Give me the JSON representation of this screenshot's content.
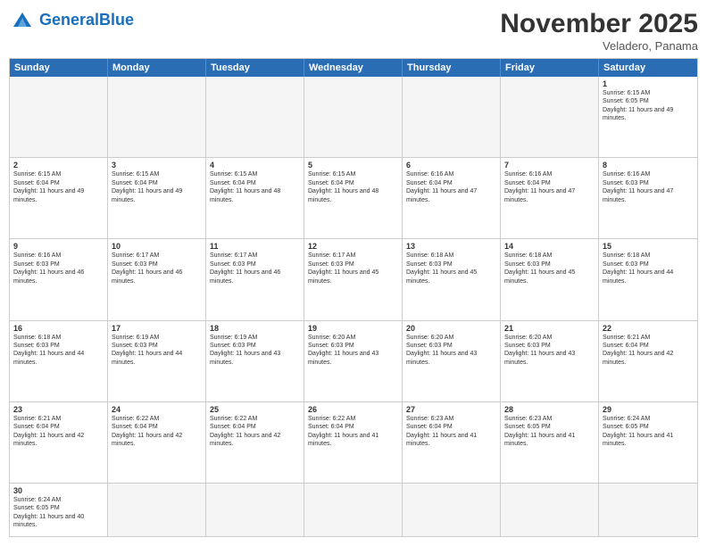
{
  "header": {
    "logo_general": "General",
    "logo_blue": "Blue",
    "title": "November 2025",
    "subtitle": "Veladero, Panama"
  },
  "days_of_week": [
    "Sunday",
    "Monday",
    "Tuesday",
    "Wednesday",
    "Thursday",
    "Friday",
    "Saturday"
  ],
  "weeks": [
    [
      {
        "day": "",
        "empty": true
      },
      {
        "day": "",
        "empty": true
      },
      {
        "day": "",
        "empty": true
      },
      {
        "day": "",
        "empty": true
      },
      {
        "day": "",
        "empty": true
      },
      {
        "day": "",
        "empty": true
      },
      {
        "day": "1",
        "sunrise": "Sunrise: 6:15 AM",
        "sunset": "Sunset: 6:05 PM",
        "daylight": "Daylight: 11 hours and 49 minutes."
      }
    ],
    [
      {
        "day": "2",
        "sunrise": "Sunrise: 6:15 AM",
        "sunset": "Sunset: 6:04 PM",
        "daylight": "Daylight: 11 hours and 49 minutes."
      },
      {
        "day": "3",
        "sunrise": "Sunrise: 6:15 AM",
        "sunset": "Sunset: 6:04 PM",
        "daylight": "Daylight: 11 hours and 49 minutes."
      },
      {
        "day": "4",
        "sunrise": "Sunrise: 6:15 AM",
        "sunset": "Sunset: 6:04 PM",
        "daylight": "Daylight: 11 hours and 48 minutes."
      },
      {
        "day": "5",
        "sunrise": "Sunrise: 6:15 AM",
        "sunset": "Sunset: 6:04 PM",
        "daylight": "Daylight: 11 hours and 48 minutes."
      },
      {
        "day": "6",
        "sunrise": "Sunrise: 6:16 AM",
        "sunset": "Sunset: 6:04 PM",
        "daylight": "Daylight: 11 hours and 47 minutes."
      },
      {
        "day": "7",
        "sunrise": "Sunrise: 6:16 AM",
        "sunset": "Sunset: 6:04 PM",
        "daylight": "Daylight: 11 hours and 47 minutes."
      },
      {
        "day": "8",
        "sunrise": "Sunrise: 6:16 AM",
        "sunset": "Sunset: 6:03 PM",
        "daylight": "Daylight: 11 hours and 47 minutes."
      }
    ],
    [
      {
        "day": "9",
        "sunrise": "Sunrise: 6:16 AM",
        "sunset": "Sunset: 6:03 PM",
        "daylight": "Daylight: 11 hours and 46 minutes."
      },
      {
        "day": "10",
        "sunrise": "Sunrise: 6:17 AM",
        "sunset": "Sunset: 6:03 PM",
        "daylight": "Daylight: 11 hours and 46 minutes."
      },
      {
        "day": "11",
        "sunrise": "Sunrise: 6:17 AM",
        "sunset": "Sunset: 6:03 PM",
        "daylight": "Daylight: 11 hours and 46 minutes."
      },
      {
        "day": "12",
        "sunrise": "Sunrise: 6:17 AM",
        "sunset": "Sunset: 6:03 PM",
        "daylight": "Daylight: 11 hours and 45 minutes."
      },
      {
        "day": "13",
        "sunrise": "Sunrise: 6:18 AM",
        "sunset": "Sunset: 6:03 PM",
        "daylight": "Daylight: 11 hours and 45 minutes."
      },
      {
        "day": "14",
        "sunrise": "Sunrise: 6:18 AM",
        "sunset": "Sunset: 6:03 PM",
        "daylight": "Daylight: 11 hours and 45 minutes."
      },
      {
        "day": "15",
        "sunrise": "Sunrise: 6:18 AM",
        "sunset": "Sunset: 6:03 PM",
        "daylight": "Daylight: 11 hours and 44 minutes."
      }
    ],
    [
      {
        "day": "16",
        "sunrise": "Sunrise: 6:18 AM",
        "sunset": "Sunset: 6:03 PM",
        "daylight": "Daylight: 11 hours and 44 minutes."
      },
      {
        "day": "17",
        "sunrise": "Sunrise: 6:19 AM",
        "sunset": "Sunset: 6:03 PM",
        "daylight": "Daylight: 11 hours and 44 minutes."
      },
      {
        "day": "18",
        "sunrise": "Sunrise: 6:19 AM",
        "sunset": "Sunset: 6:03 PM",
        "daylight": "Daylight: 11 hours and 43 minutes."
      },
      {
        "day": "19",
        "sunrise": "Sunrise: 6:20 AM",
        "sunset": "Sunset: 6:03 PM",
        "daylight": "Daylight: 11 hours and 43 minutes."
      },
      {
        "day": "20",
        "sunrise": "Sunrise: 6:20 AM",
        "sunset": "Sunset: 6:03 PM",
        "daylight": "Daylight: 11 hours and 43 minutes."
      },
      {
        "day": "21",
        "sunrise": "Sunrise: 6:20 AM",
        "sunset": "Sunset: 6:03 PM",
        "daylight": "Daylight: 11 hours and 43 minutes."
      },
      {
        "day": "22",
        "sunrise": "Sunrise: 6:21 AM",
        "sunset": "Sunset: 6:04 PM",
        "daylight": "Daylight: 11 hours and 42 minutes."
      }
    ],
    [
      {
        "day": "23",
        "sunrise": "Sunrise: 6:21 AM",
        "sunset": "Sunset: 6:04 PM",
        "daylight": "Daylight: 11 hours and 42 minutes."
      },
      {
        "day": "24",
        "sunrise": "Sunrise: 6:22 AM",
        "sunset": "Sunset: 6:04 PM",
        "daylight": "Daylight: 11 hours and 42 minutes."
      },
      {
        "day": "25",
        "sunrise": "Sunrise: 6:22 AM",
        "sunset": "Sunset: 6:04 PM",
        "daylight": "Daylight: 11 hours and 42 minutes."
      },
      {
        "day": "26",
        "sunrise": "Sunrise: 6:22 AM",
        "sunset": "Sunset: 6:04 PM",
        "daylight": "Daylight: 11 hours and 41 minutes."
      },
      {
        "day": "27",
        "sunrise": "Sunrise: 6:23 AM",
        "sunset": "Sunset: 6:04 PM",
        "daylight": "Daylight: 11 hours and 41 minutes."
      },
      {
        "day": "28",
        "sunrise": "Sunrise: 6:23 AM",
        "sunset": "Sunset: 6:05 PM",
        "daylight": "Daylight: 11 hours and 41 minutes."
      },
      {
        "day": "29",
        "sunrise": "Sunrise: 6:24 AM",
        "sunset": "Sunset: 6:05 PM",
        "daylight": "Daylight: 11 hours and 41 minutes."
      }
    ],
    [
      {
        "day": "30",
        "sunrise": "Sunrise: 6:24 AM",
        "sunset": "Sunset: 6:05 PM",
        "daylight": "Daylight: 11 hours and 40 minutes."
      },
      {
        "day": "",
        "empty": true
      },
      {
        "day": "",
        "empty": true
      },
      {
        "day": "",
        "empty": true
      },
      {
        "day": "",
        "empty": true
      },
      {
        "day": "",
        "empty": true
      },
      {
        "day": "",
        "empty": true
      }
    ]
  ]
}
